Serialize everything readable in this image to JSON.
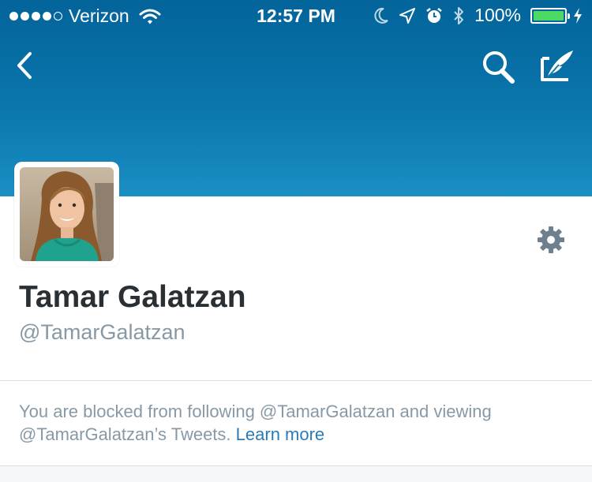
{
  "status_bar": {
    "carrier": "Verizon",
    "time": "12:57 PM",
    "battery": "100%",
    "battery_level": 1.0,
    "icons": [
      "signal-dots-icon",
      "wifi-icon",
      "moon-icon",
      "location-arrow-icon",
      "alarm-icon",
      "bluetooth-icon",
      "battery-icon",
      "charging-bolt-icon"
    ]
  },
  "nav": {
    "back_icon": "chevron-left-icon",
    "search_icon": "search-icon",
    "compose_icon": "compose-tweet-icon"
  },
  "profile": {
    "name": "Tamar Galatzan",
    "handle": "@TamarGalatzan",
    "settings_icon": "gear-icon"
  },
  "notice": {
    "text": "You are blocked from following @TamarGalatzan and viewing @TamarGalatzan’s Tweets.",
    "link": "Learn more"
  },
  "colors": {
    "header_gradient_top": "#03649a",
    "header_gradient_bottom": "#1a8fc4",
    "link": "#2b7bb9",
    "name_text": "#292f33",
    "secondary_text": "#8899a6",
    "battery_fill": "#4cd964"
  }
}
